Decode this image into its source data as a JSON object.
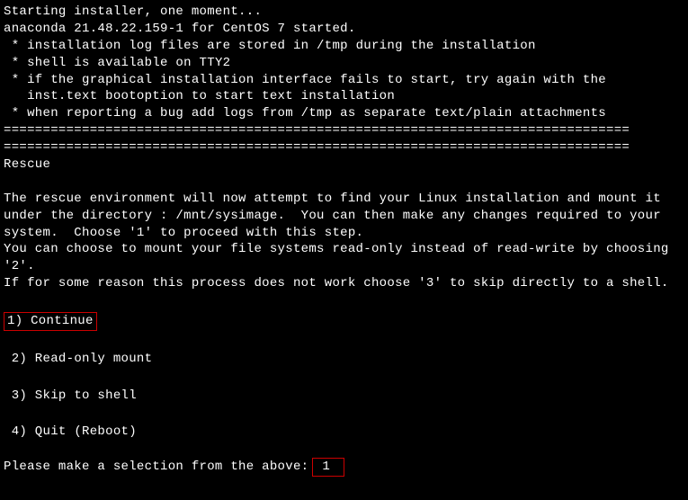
{
  "boot": {
    "line1": "Starting installer, one moment...",
    "line2": "anaconda 21.48.22.159-1 for CentOS 7 started.",
    "bullet1": " * installation log files are stored in /tmp during the installation",
    "bullet2": " * shell is available on TTY2",
    "bullet3": " * if the graphical installation interface fails to start, try again with the",
    "bullet3b": "   inst.text bootoption to start text installation",
    "bullet4": " * when reporting a bug add logs from /tmp as separate text/plain attachments"
  },
  "divider1": "================================================================================",
  "divider2": "================================================================================",
  "section_title": "Rescue",
  "body": {
    "p1": "The rescue environment will now attempt to find your Linux installation and mount it under the directory : /mnt/sysimage.  You can then make any changes required to your system.  Choose '1' to proceed with this step.",
    "p2": "You can choose to mount your file systems read-only instead of read-write by choosing '2'.",
    "p3": "If for some reason this process does not work choose '3' to skip directly to a shell."
  },
  "options": {
    "o1": "1) Continue",
    "o2": "2) Read-only mount",
    "o3": "3) Skip to shell",
    "o4": "4) Quit (Reboot)"
  },
  "prompt": {
    "label": "Please make a selection from the above: ",
    "value": "1"
  }
}
